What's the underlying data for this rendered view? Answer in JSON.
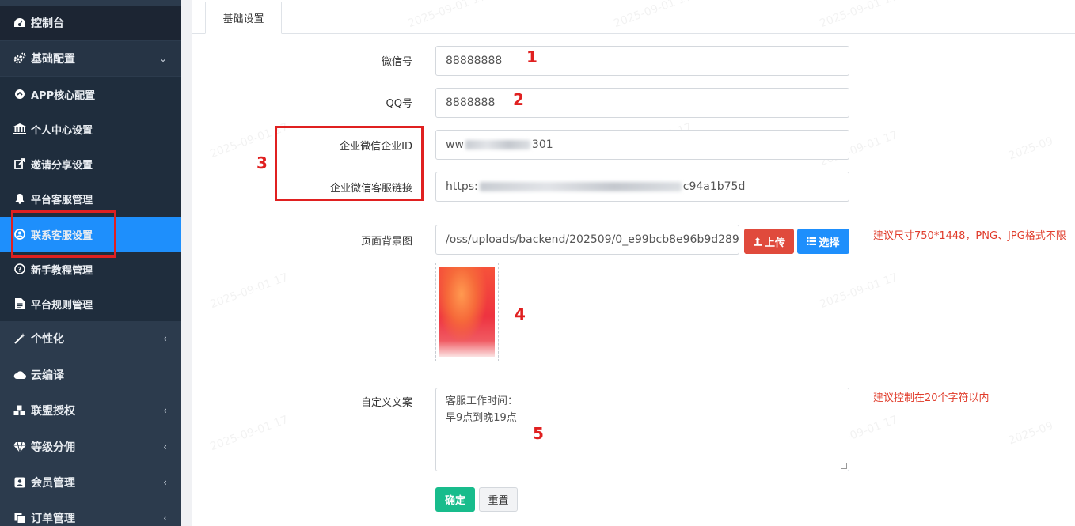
{
  "sidebar": {
    "items": [
      {
        "label": "控制台",
        "icon": "dashboard-icon"
      },
      {
        "label": "基础配置",
        "icon": "cogs-icon"
      },
      {
        "label": "APP核心配置",
        "icon": "circle-icon"
      },
      {
        "label": "个人中心设置",
        "icon": "bank-icon"
      },
      {
        "label": "邀请分享设置",
        "icon": "share-icon"
      },
      {
        "label": "平台客服管理",
        "icon": "bell-icon"
      },
      {
        "label": "联系客服设置",
        "icon": "user-circle-icon"
      },
      {
        "label": "新手教程管理",
        "icon": "question-icon"
      },
      {
        "label": "平台规则管理",
        "icon": "file-icon"
      },
      {
        "label": "个性化",
        "icon": "magic-icon"
      },
      {
        "label": "云编译",
        "icon": "cloud-icon"
      },
      {
        "label": "联盟授权",
        "icon": "cubes-icon"
      },
      {
        "label": "等级分佣",
        "icon": "diamond-icon"
      },
      {
        "label": "会员管理",
        "icon": "member-icon"
      },
      {
        "label": "订单管理",
        "icon": "copy-icon"
      }
    ]
  },
  "tab": {
    "label": "基础设置"
  },
  "form": {
    "wechat": {
      "label": "微信号",
      "value": "88888888"
    },
    "qq": {
      "label": "QQ号",
      "value": "8888888"
    },
    "corp_id": {
      "label": "企业微信企业ID",
      "value_prefix": "ww",
      "value_suffix": "301"
    },
    "corp_link": {
      "label": "企业微信客服链接",
      "value_prefix": "https:",
      "value_suffix": "c94a1b75d"
    },
    "bg_image": {
      "label": "页面背景图",
      "value": "/oss/uploads/backend/202509/0_e99bcb8e96b9d289",
      "upload_label": "上传",
      "select_label": "选择",
      "hint": "建议尺寸750*1448，PNG、JPG格式不限"
    },
    "custom_text": {
      "label": "自定义文案",
      "line1": "客服工作时间：",
      "line2": "早9点到晚19点",
      "hint": "建议控制在20个字符以内"
    },
    "confirm_label": "确定",
    "reset_label": "重置"
  },
  "annotations": [
    "1",
    "2",
    "3",
    "4",
    "5"
  ],
  "colors": {
    "sidebar": "#2c3b4d",
    "active": "#1e8ffc",
    "danger": "#e04a3c",
    "success": "#18bc8c",
    "annotation": "#e02020"
  }
}
